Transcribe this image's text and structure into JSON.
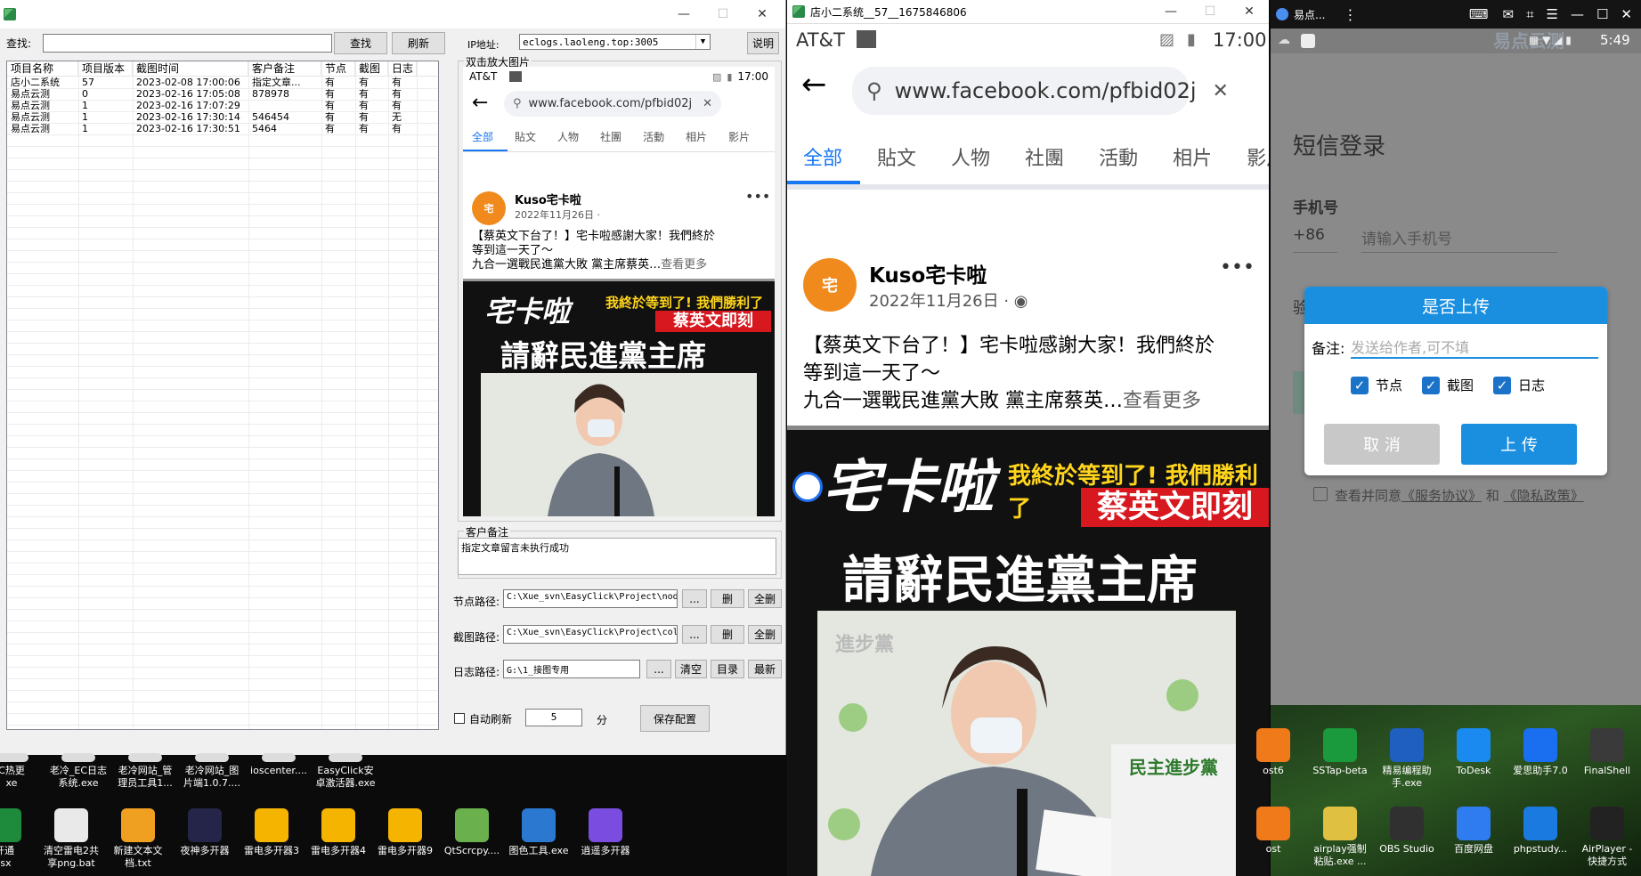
{
  "left_window": {
    "search_label": "查找:",
    "search_value": "",
    "find_button": "查找",
    "refresh_button": "刷新",
    "ip_label": "IP地址:",
    "ip_value": "eclogs.laoleng.top:3005",
    "help_button": "说明",
    "preview_label": "双击放大图片",
    "columns": [
      "项目名称",
      "项目版本",
      "截图时间",
      "客户备注",
      "节点",
      "截图",
      "日志"
    ],
    "rows": [
      [
        "店小二系统",
        "57",
        "2023-02-08 17:00:06",
        "指定文章...",
        "有",
        "有",
        "有"
      ],
      [
        "易点云测",
        "0",
        "2023-02-16 17:05:08",
        "878978",
        "有",
        "有",
        "有"
      ],
      [
        "易点云测",
        "1",
        "2023-02-16 17:07:29",
        "",
        "有",
        "有",
        "有"
      ],
      [
        "易点云测",
        "1",
        "2023-02-16 17:30:14",
        "546454",
        "有",
        "有",
        "无"
      ],
      [
        "易点云测",
        "1",
        "2023-02-16 17:30:51",
        "5464",
        "有",
        "有",
        "有"
      ]
    ],
    "remark_group_label": "客户备注",
    "remark_text": "指定文章留言未执行成功",
    "node_path_label": "节点路径:",
    "node_path_value": "C:\\Xue_svn\\EasyClick\\Project\\nod",
    "shot_path_label": "截图路径:",
    "shot_path_value": "C:\\Xue_svn\\EasyClick\\Project\\col",
    "log_path_label": "日志路径:",
    "log_path_value": "G:\\1_接图专用",
    "dots_button": "...",
    "delete_button": "删",
    "delete_all_button": "全删",
    "clear_button": "清空",
    "dir_button": "目录",
    "latest_button": "最新",
    "auto_refresh_label": "自动刷新",
    "auto_refresh_value": "5",
    "minutes_label": "分",
    "save_config_button": "保存配置"
  },
  "facebook": {
    "carrier": "AT&T",
    "time": "17:00",
    "url": "www.facebook.com/pfbid02j",
    "tabs": [
      "全部",
      "貼文",
      "人物",
      "社團",
      "活動",
      "相片",
      "影片"
    ],
    "page_name": "Kuso宅卡啦",
    "post_date": "2022年11月26日 ·",
    "post_line1": "【蔡英文下台了！】宅卡啦感謝大家！我們終於",
    "post_line2": "等到這一天了～",
    "post_line3": "九合一選戰民進黨大敗 黨主席蔡英…",
    "see_more": "查看更多",
    "img_brand": "宅卡啦",
    "img_yellow": "我終於等到了! 我們勝利了",
    "img_red": "蔡英文即刻",
    "img_headline": "請辭民進黨主席",
    "podium_text": "民主進步黨",
    "backdrop_text": "進步黨"
  },
  "center_window": {
    "title": "店小二系统__57__1675846806"
  },
  "right_window": {
    "tab_title": "易点...",
    "time": "5:49",
    "watermark": "易点云测",
    "login_title": "短信登录",
    "phone_label": "手机号",
    "country_code": "+86",
    "phone_placeholder": "请输入手机号",
    "dialog_title": "是否上传",
    "remark_label": "备注:",
    "remark_placeholder": "发送给作者,可不填",
    "check_node": "节点",
    "check_shot": "截图",
    "check_log": "日志",
    "cancel_button": "取 消",
    "upload_button": "上 传",
    "agree_prefix": "查看并同意",
    "service_link": "《服务协议》",
    "and_text": "和",
    "privacy_link": "《隐私政策》"
  },
  "desktop_left": [
    {
      "label": "C热更\nxe"
    },
    {
      "label": "老冷_EC日志\n系统.exe"
    },
    {
      "label": "老冷网站_管\n理员工具1..."
    },
    {
      "label": "老冷网站_图\n片端1.0.7...."
    },
    {
      "label": "ioscenter...."
    },
    {
      "label": "EasyClick安\n卓激活器.exe"
    }
  ],
  "desktop_left_row2": [
    {
      "label": "开通\nlsx",
      "color": "#1e8a3c"
    },
    {
      "label": "清空雷电2共\n享png.bat",
      "color": "#e9e9e9"
    },
    {
      "label": "新建文本文\n档.txt",
      "color": "#f0a020"
    },
    {
      "label": "夜神多开器",
      "color": "#25254a"
    },
    {
      "label": "雷电多开器3",
      "color": "#f5b400"
    },
    {
      "label": "雷电多开器4",
      "color": "#f5b400"
    },
    {
      "label": "雷电多开器9",
      "color": "#f5b400"
    },
    {
      "label": "QtScrcpy....",
      "color": "#6ab04c"
    },
    {
      "label": "图色工具.exe",
      "color": "#2b78d0"
    },
    {
      "label": "逍遥多开器",
      "color": "#7a4de0"
    }
  ],
  "desktop_right": [
    {
      "label": "ost6",
      "color": "#f07a1a"
    },
    {
      "label": "SSTap-beta",
      "color": "#1a9a3c"
    },
    {
      "label": "精易编程助\n手.exe",
      "color": "#1f5fbf"
    },
    {
      "label": "ToDesk",
      "color": "#1a8af0"
    },
    {
      "label": "爱思助手7.0",
      "color": "#1a6ff0"
    },
    {
      "label": "FinalShell",
      "color": "#3a3a3a"
    }
  ],
  "desktop_right_row2": [
    {
      "label": "ost",
      "color": "#f07a1a"
    },
    {
      "label": "airplay强制\n粘贴.exe ...",
      "color": "#e0c040"
    },
    {
      "label": "OBS Studio",
      "color": "#303030"
    },
    {
      "label": "百度网盘",
      "color": "#2f7bf0"
    },
    {
      "label": "phpstudy...",
      "color": "#1a7ae0"
    },
    {
      "label": "AirPlayer -\n快捷方式",
      "color": "#222"
    }
  ]
}
